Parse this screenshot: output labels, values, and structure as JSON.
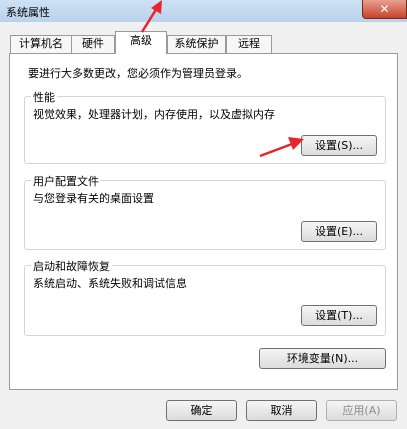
{
  "window": {
    "title": "系统属性",
    "close_label": "✕"
  },
  "tabs": [
    {
      "label": "计算机名"
    },
    {
      "label": "硬件"
    },
    {
      "label": "高级"
    },
    {
      "label": "系统保护"
    },
    {
      "label": "远程"
    }
  ],
  "advanced": {
    "admin_note": "要进行大多数更改，您必须作为管理员登录。",
    "performance": {
      "title": "性能",
      "description": "视觉效果，处理器计划，内存使用，以及虚拟内存",
      "button": "设置(S)..."
    },
    "user_profiles": {
      "title": "用户配置文件",
      "description": "与您登录有关的桌面设置",
      "button": "设置(E)..."
    },
    "startup_recovery": {
      "title": "启动和故障恢复",
      "description": "系统启动、系统失败和调试信息",
      "button": "设置(T)..."
    },
    "env_button": "环境变量(N)..."
  },
  "footer": {
    "ok": "确定",
    "cancel": "取消",
    "apply": "应用(A)"
  },
  "annotation_color": "#e8232a"
}
